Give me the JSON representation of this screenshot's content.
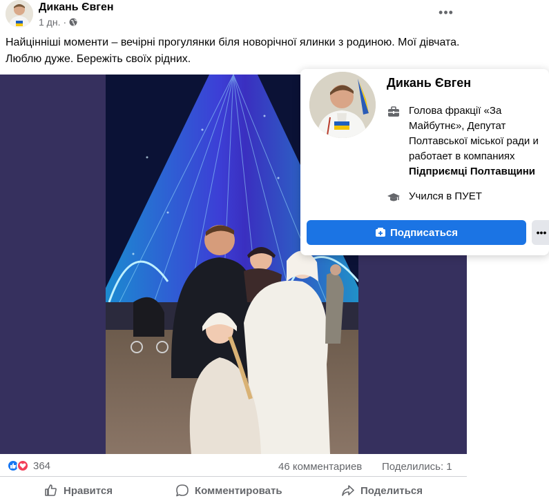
{
  "post": {
    "author": "Дикань Євген",
    "time": "1 дн.",
    "more_label": "•••",
    "text": "Найцінніші моменти – вечірні прогулянки біля новорічної ялинки з родиною. Мої дівчата. Люблю дуже. Бережіть своїх рідних.",
    "reaction_count": "364",
    "comments": "46 комментариев",
    "shares": "Поделились: 1",
    "actions": {
      "like": "Нравится",
      "comment": "Комментировать",
      "share": "Поделиться"
    }
  },
  "hover_card": {
    "name": "Дикань Євген",
    "work_text": "Голова фракції «За Майбутнє», Депутат Полтавської міської ради и работает в компаниях",
    "work_company": "Підприємці Полтавщини",
    "education": "Учился в ПУЕТ",
    "subscribe_label": "Подписаться",
    "more_label": "•••"
  },
  "colors": {
    "accent": "#1b74e4",
    "like": "#1877f2",
    "love": "#f33e58",
    "secondary_text": "#65676b",
    "photo_backdrop": "#36305e"
  }
}
